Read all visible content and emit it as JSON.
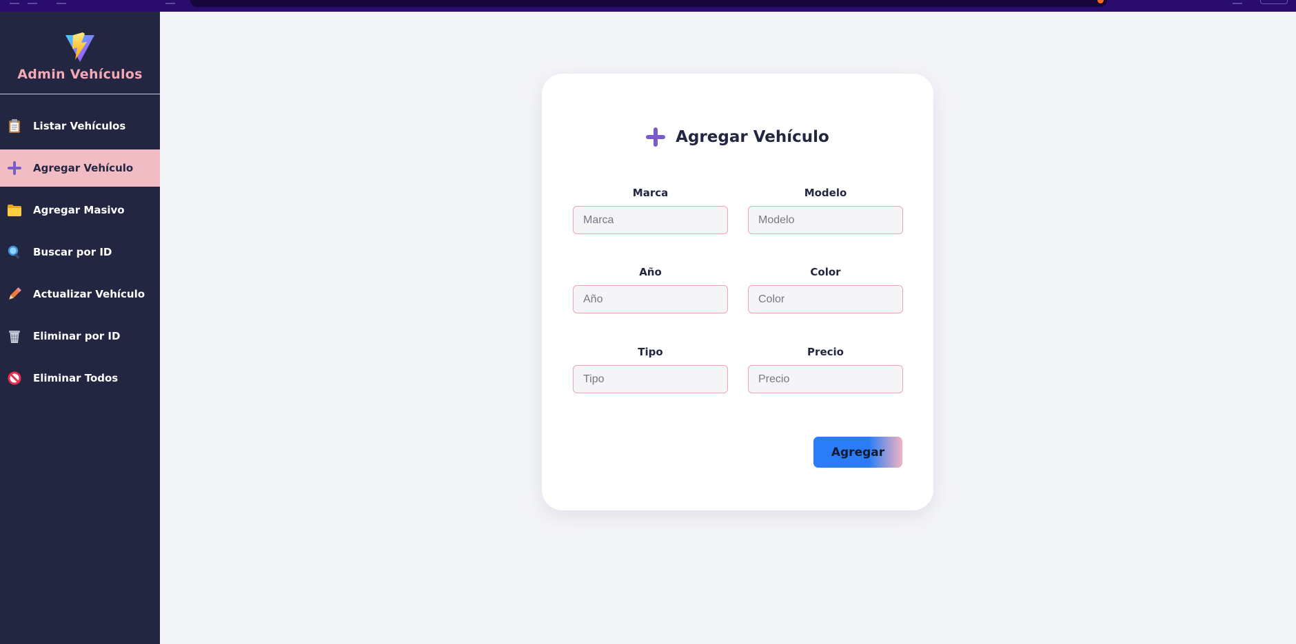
{
  "brand": {
    "title": "Admin Vehículos",
    "logo_icon": "vite-bolt-logo"
  },
  "nav": {
    "items": [
      {
        "label": "Listar Vehículos",
        "icon": "clipboard-icon",
        "active": false
      },
      {
        "label": "Agregar Vehículo",
        "icon": "plus-icon",
        "active": true
      },
      {
        "label": "Agregar Masivo",
        "icon": "folder-icon",
        "active": false
      },
      {
        "label": "Buscar por ID",
        "icon": "magnifier-icon",
        "active": false
      },
      {
        "label": "Actualizar Vehículo",
        "icon": "pencil-icon",
        "active": false
      },
      {
        "label": "Eliminar por ID",
        "icon": "trash-icon",
        "active": false
      },
      {
        "label": "Eliminar Todos",
        "icon": "prohibited-icon",
        "active": false
      }
    ]
  },
  "form": {
    "title": "Agregar Vehículo",
    "title_icon": "plus-icon",
    "fields": {
      "marca": {
        "label": "Marca",
        "placeholder": "Marca",
        "value": ""
      },
      "modelo": {
        "label": "Modelo",
        "placeholder": "Modelo",
        "value": ""
      },
      "anio": {
        "label": "Año",
        "placeholder": "Año",
        "value": ""
      },
      "color": {
        "label": "Color",
        "placeholder": "Color",
        "value": ""
      },
      "tipo": {
        "label": "Tipo",
        "placeholder": "Tipo",
        "value": ""
      },
      "precio": {
        "label": "Precio",
        "placeholder": "Precio",
        "value": ""
      }
    },
    "submit_label": "Agregar"
  },
  "colors": {
    "sidebar_bg": "#222640",
    "brand_text": "#f4a9b8",
    "active_item_bg": "#f2bcc5",
    "accent_purple": "#7a5cc8",
    "button_blue": "#2a7cf7",
    "input_border": "#f2a3b1",
    "page_bg": "#f4f5f9"
  }
}
